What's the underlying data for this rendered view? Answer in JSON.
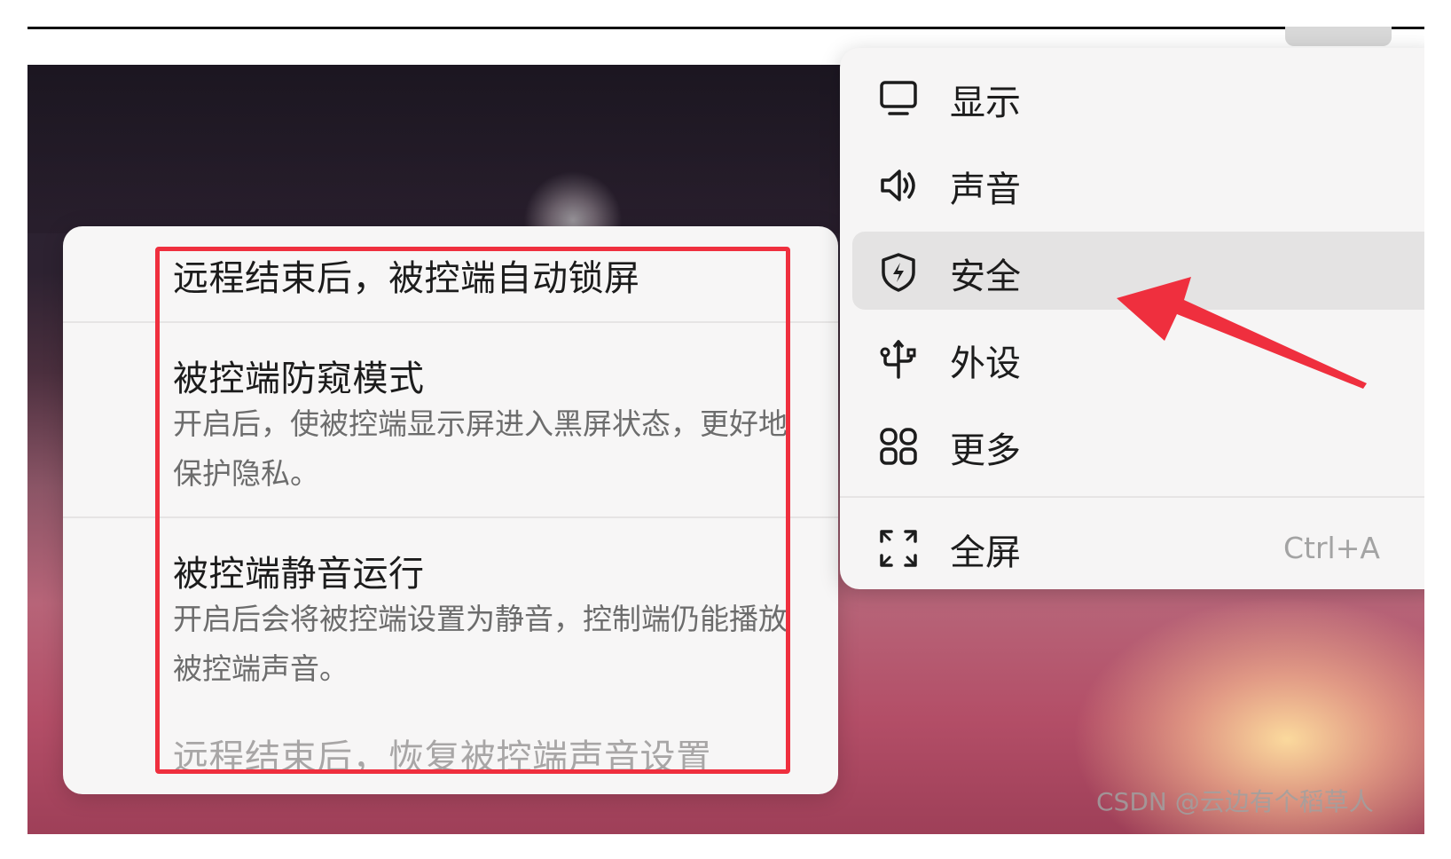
{
  "security_submenu": {
    "items": [
      {
        "title": "远程结束后，被控端自动锁屏",
        "description": ""
      },
      {
        "title": "被控端防窥模式",
        "description": "开启后，使被控端显示屏进入黑屏状态，更好地保护隐私。"
      },
      {
        "title": "被控端静音运行",
        "description": "开启后会将被控端设置为静音，控制端仍能播放被控端声音。"
      },
      {
        "title": "远程结束后，恢复被控端声音设置",
        "description": ""
      }
    ]
  },
  "main_menu": {
    "items": [
      {
        "label": "显示",
        "icon": "monitor-icon",
        "selected": false
      },
      {
        "label": "声音",
        "icon": "speaker-icon",
        "selected": false
      },
      {
        "label": "安全",
        "icon": "shield-icon",
        "selected": true
      },
      {
        "label": "外设",
        "icon": "usb-icon",
        "selected": false
      },
      {
        "label": "更多",
        "icon": "grid-icon",
        "selected": false
      }
    ],
    "fullscreen": {
      "label": "全屏",
      "icon": "fullscreen-icon",
      "shortcut": "Ctrl+A"
    }
  },
  "annotations": {
    "highlight_color": "#ef2f3e",
    "arrow_color": "#ef2f3e"
  },
  "watermark": "CSDN @云边有个稻草人"
}
